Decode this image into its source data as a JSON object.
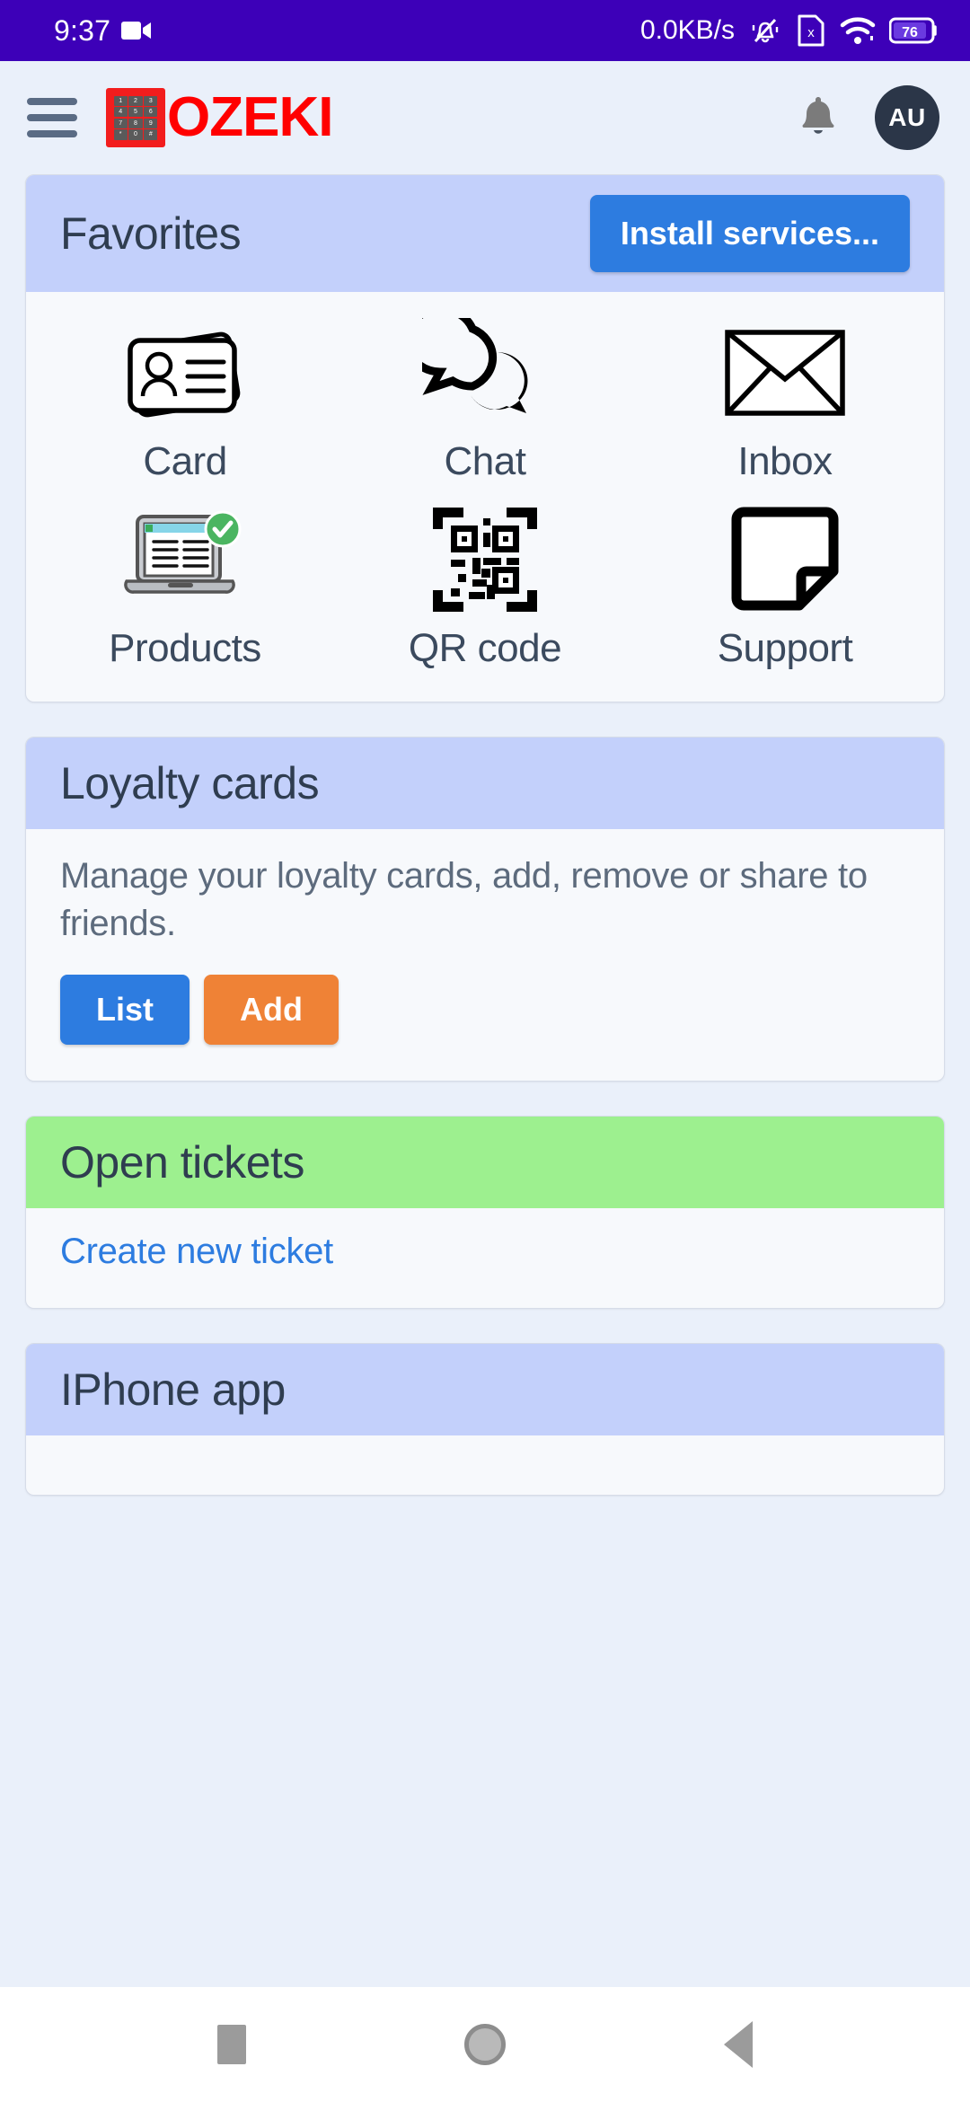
{
  "status_bar": {
    "time": "9:37",
    "network_speed": "0.0KB/s",
    "battery_level": "76",
    "icons": [
      "video-camera-icon",
      "mute-bell-icon",
      "sim-missing-icon",
      "wifi-icon",
      "battery-icon"
    ]
  },
  "header": {
    "menu_icon": "hamburger-menu-icon",
    "logo_text": "OZEKI",
    "logo_keys": [
      "1",
      "2",
      "3",
      "4",
      "5",
      "6",
      "7",
      "8",
      "9",
      "*",
      "0",
      "#"
    ],
    "notification_icon": "bell-icon",
    "avatar_initials": "AU"
  },
  "favorites": {
    "title": "Favorites",
    "install_button": "Install services...",
    "items": [
      {
        "label": "Card",
        "icon": "id-card-icon"
      },
      {
        "label": "Chat",
        "icon": "chat-bubbles-icon"
      },
      {
        "label": "Inbox",
        "icon": "envelope-icon"
      },
      {
        "label": "Products",
        "icon": "laptop-check-icon"
      },
      {
        "label": "QR code",
        "icon": "qr-code-icon"
      },
      {
        "label": "Support",
        "icon": "sticky-note-icon"
      }
    ]
  },
  "loyalty": {
    "title": "Loyalty cards",
    "description": "Manage your loyalty cards, add, remove or share to friends.",
    "list_button": "List",
    "add_button": "Add"
  },
  "tickets": {
    "title": "Open tickets",
    "create_link": "Create new ticket"
  },
  "iphone": {
    "title": "IPhone app"
  },
  "navbar": {
    "recents": "recents-square-icon",
    "home": "home-circle-icon",
    "back": "back-triangle-icon"
  },
  "colors": {
    "status_bar": "#3d00b8",
    "page_bg": "#eaf0fa",
    "card_header_blue": "#c3d0fb",
    "card_header_green": "#9df08f",
    "accent_blue": "#2d7ce0",
    "accent_orange": "#ef8236",
    "logo_red": "#ff0000",
    "avatar_bg": "#2b3648"
  }
}
